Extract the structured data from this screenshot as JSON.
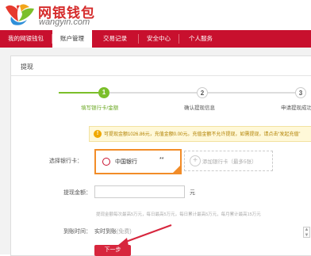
{
  "brand": {
    "name_cn": "网银钱包",
    "name_en": "wangyin.com",
    "accent": "#c8102e"
  },
  "nav": {
    "items": [
      {
        "label": "我的网银钱包",
        "active": false
      },
      {
        "label": "账户管理",
        "active": true
      },
      {
        "label": "交易记录",
        "active": false
      },
      {
        "label": "安全中心",
        "active": false
      },
      {
        "label": "个人服务",
        "active": false
      }
    ]
  },
  "panel": {
    "title": "提现"
  },
  "steps": [
    {
      "number": "1",
      "label": "填写银行卡/金额",
      "status": "current"
    },
    {
      "number": "2",
      "label": "确认提现信息",
      "status": "pending"
    },
    {
      "number": "3",
      "label": "申请提现成功",
      "status": "pending"
    }
  ],
  "notice": {
    "icon": "warning-icon",
    "text": "可提现金额1026.86元，充值金额0.00元。充值金额不允许提现，如需提现，请点击“发起充值”"
  },
  "form": {
    "bank_label": "选择银行卡：",
    "selected_bank": {
      "name": "中国银行",
      "masked_number": "**",
      "icon": "bank-of-china-icon"
    },
    "add_card_text": "添加银行卡（最多5张）",
    "amount_label": "提现金额：",
    "amount_value": "",
    "amount_unit": "元",
    "limit_text": "提现金额每次最高5万元，每日最高5万元，每日累计最高5万元，每月累计最高15万元",
    "arrival_label": "到账时间：",
    "arrival_value": "实时到账",
    "arrival_sub": "(免费)",
    "next_button": "下一步"
  }
}
